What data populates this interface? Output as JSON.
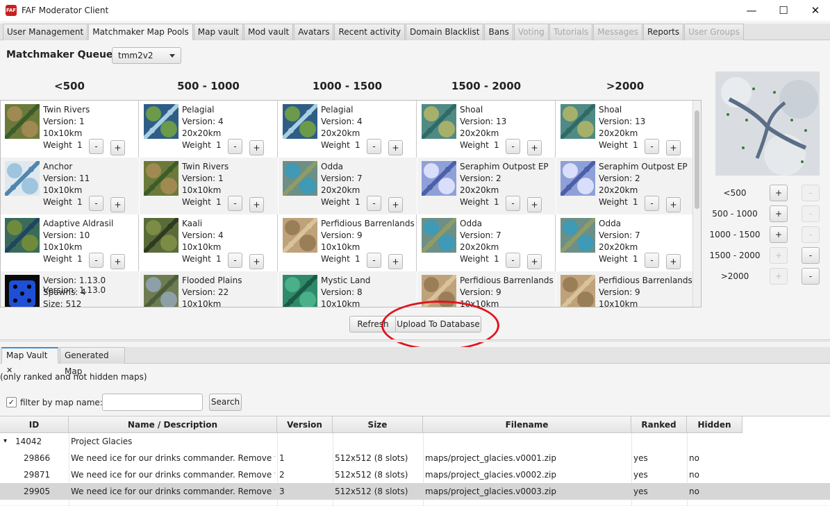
{
  "window": {
    "title": "FAF Moderator Client",
    "icon_text": "FAF",
    "minimize": "—",
    "maximize": "☐",
    "close": "✕"
  },
  "tabs": [
    {
      "label": "User Management",
      "state": "normal"
    },
    {
      "label": "Matchmaker Map Pools",
      "state": "active"
    },
    {
      "label": "Map vault",
      "state": "normal"
    },
    {
      "label": "Mod vault",
      "state": "normal"
    },
    {
      "label": "Avatars",
      "state": "normal"
    },
    {
      "label": "Recent activity",
      "state": "normal"
    },
    {
      "label": "Domain Blacklist",
      "state": "normal"
    },
    {
      "label": "Bans",
      "state": "normal"
    },
    {
      "label": "Voting",
      "state": "disabled"
    },
    {
      "label": "Tutorials",
      "state": "disabled"
    },
    {
      "label": "Messages",
      "state": "disabled"
    },
    {
      "label": "Reports",
      "state": "normal"
    },
    {
      "label": "User Groups",
      "state": "disabled"
    }
  ],
  "queue": {
    "label": "Matchmaker Queue:",
    "value": "tmm2v2"
  },
  "brackets": [
    {
      "header": "<500",
      "maps": [
        {
          "name": "Twin Rivers",
          "version": "Version: 1",
          "size": "10x10km",
          "weight_label": "Weight",
          "weight": "1",
          "thumb": "river"
        },
        {
          "name": "Anchor",
          "version": "Version: 11",
          "size": "10x10km",
          "weight_label": "Weight",
          "weight": "1",
          "thumb": "snow"
        },
        {
          "name": "Adaptive Aldrasil",
          "version": "Version: 10",
          "size": "10x10km",
          "weight_label": "Weight",
          "weight": "1",
          "thumb": "island"
        },
        {
          "name": "",
          "version": "Version: 1.13.0",
          "size": "",
          "weight_label": "",
          "weight": "",
          "thumb": "dice",
          "overlap1": "Spawns: 4",
          "overlap2": "Size: 512"
        }
      ]
    },
    {
      "header": "500 - 1000",
      "maps": [
        {
          "name": "Pelagial",
          "version": "Version: 4",
          "size": "20x20km",
          "weight_label": "Weight",
          "weight": "1",
          "thumb": "sea"
        },
        {
          "name": "Twin Rivers",
          "version": "Version: 1",
          "size": "10x10km",
          "weight_label": "Weight",
          "weight": "1",
          "thumb": "river"
        },
        {
          "name": "Kaali",
          "version": "Version: 4",
          "size": "10x10km",
          "weight_label": "Weight",
          "weight": "1",
          "thumb": "jungle"
        },
        {
          "name": "Flooded Plains",
          "version": "Version: 22",
          "size": "10x10km",
          "weight_label": "",
          "weight": "",
          "thumb": "plains"
        }
      ]
    },
    {
      "header": "1000 - 1500",
      "maps": [
        {
          "name": "Pelagial",
          "version": "Version: 4",
          "size": "20x20km",
          "weight_label": "Weight",
          "weight": "1",
          "thumb": "sea"
        },
        {
          "name": "Odda",
          "version": "Version: 7",
          "size": "20x20km",
          "weight_label": "Weight",
          "weight": "1",
          "thumb": "lake"
        },
        {
          "name": "Perfidious Barrenlands",
          "version": "Version: 9",
          "size": "10x10km",
          "weight_label": "Weight",
          "weight": "1",
          "thumb": "desert"
        },
        {
          "name": "Mystic Land",
          "version": "Version: 8",
          "size": "10x10km",
          "weight_label": "",
          "weight": "",
          "thumb": "mystic"
        }
      ]
    },
    {
      "header": "1500 - 2000",
      "maps": [
        {
          "name": "Shoal",
          "version": "Version: 13",
          "size": "20x20km",
          "weight_label": "Weight",
          "weight": "1",
          "thumb": "shoal"
        },
        {
          "name": "Seraphim Outpost EP",
          "version": "Version: 2",
          "size": "20x20km",
          "weight_label": "Weight",
          "weight": "1",
          "thumb": "outpost"
        },
        {
          "name": "Odda",
          "version": "Version: 7",
          "size": "20x20km",
          "weight_label": "Weight",
          "weight": "1",
          "thumb": "lake"
        },
        {
          "name": "Perfidious Barrenlands",
          "version": "Version: 9",
          "size": "10x10km",
          "weight_label": "",
          "weight": "",
          "thumb": "desert"
        }
      ]
    },
    {
      "header": ">2000",
      "maps": [
        {
          "name": "Shoal",
          "version": "Version: 13",
          "size": "20x20km",
          "weight_label": "Weight",
          "weight": "1",
          "thumb": "shoal"
        },
        {
          "name": "Seraphim Outpost EP",
          "version": "Version: 2",
          "size": "20x20km",
          "weight_label": "Weight",
          "weight": "1",
          "thumb": "outpost"
        },
        {
          "name": "Odda",
          "version": "Version: 7",
          "size": "20x20km",
          "weight_label": "Weight",
          "weight": "1",
          "thumb": "lake"
        },
        {
          "name": "Perfidious Barrenlands",
          "version": "Version: 9",
          "size": "10x10km",
          "weight_label": "",
          "weight": "",
          "thumb": "desert"
        }
      ]
    }
  ],
  "minus_label": "-",
  "plus_label": "+",
  "right_panel": {
    "rows": [
      {
        "label": "<500",
        "add_enabled": true,
        "remove_enabled": false
      },
      {
        "label": "500 - 1000",
        "add_enabled": true,
        "remove_enabled": false
      },
      {
        "label": "1000 - 1500",
        "add_enabled": true,
        "remove_enabled": false
      },
      {
        "label": "1500 - 2000",
        "add_enabled": false,
        "remove_enabled": true
      },
      {
        "label": ">2000",
        "add_enabled": false,
        "remove_enabled": true
      }
    ]
  },
  "actions": {
    "refresh": "Refresh",
    "upload": "Upload To Database"
  },
  "bottom_tabs": [
    {
      "label": "Map Vault",
      "close": "✕"
    },
    {
      "label": "Generated Map"
    }
  ],
  "vault": {
    "hint": "(only ranked and not hidden maps)",
    "filter_checked": true,
    "checkmark": "✓",
    "filter_label": "filter by map name:",
    "filter_value": "",
    "search": "Search"
  },
  "table": {
    "columns": [
      "ID",
      "Name / Description",
      "Version",
      "Size",
      "Filename",
      "Ranked",
      "Hidden"
    ],
    "expander": "▾",
    "rows": [
      {
        "id": "14042",
        "name": "Project Glacies",
        "version": "",
        "size": "",
        "filename": "",
        "ranked": "",
        "hidden": "",
        "parent": true,
        "selected": false
      },
      {
        "id": "29866",
        "name": "We need ice for our drinks commander. Remove thes...",
        "version": "1",
        "size": "512x512 (8 slots)",
        "filename": "maps/project_glacies.v0001.zip",
        "ranked": "yes",
        "hidden": "no",
        "parent": false,
        "selected": false
      },
      {
        "id": "29871",
        "name": "We need ice for our drinks commander. Remove thes...",
        "version": "2",
        "size": "512x512 (8 slots)",
        "filename": "maps/project_glacies.v0002.zip",
        "ranked": "yes",
        "hidden": "no",
        "parent": false,
        "selected": false
      },
      {
        "id": "29905",
        "name": "We need ice for our drinks commander. Remove thes...",
        "version": "3",
        "size": "512x512 (8 slots)",
        "filename": "maps/project_glacies.v0003.zip",
        "ranked": "yes",
        "hidden": "no",
        "parent": false,
        "selected": true
      }
    ]
  },
  "colors": {
    "highlight_ring": "#e0141e",
    "selected_row": "#d6d6d6",
    "tab_accent": "#3a8fd6"
  }
}
